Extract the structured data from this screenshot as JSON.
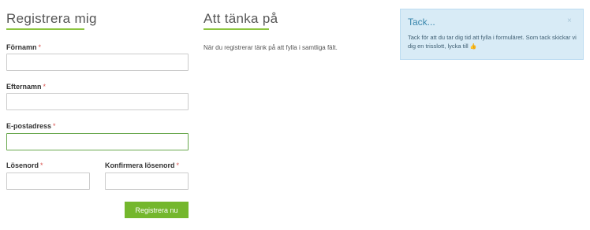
{
  "register": {
    "heading": "Registrera mig",
    "fields": {
      "firstname_label": "Förnamn",
      "lastname_label": "Efternamn",
      "email_label": "E-postadress",
      "password_label": "Lösenord",
      "confirm_label": "Konfirmera lösenord",
      "required_mark": "*"
    },
    "submit_label": "Registrera nu"
  },
  "think": {
    "heading": "Att tänka på",
    "text": "När du registrerar tänk på att fylla i samtliga fält."
  },
  "alert": {
    "title": "Tack...",
    "body": "Tack för att du tar dig tid att fylla i formuläret. Som tack skickar vi dig en trisslott, lycka till",
    "close_icon": "×",
    "thumb_icon": "👍"
  },
  "colors": {
    "accent_green": "#74b72d",
    "underline_green": "#8cc43f",
    "alert_bg": "#d8ebf6",
    "required_red": "#d9534f"
  }
}
